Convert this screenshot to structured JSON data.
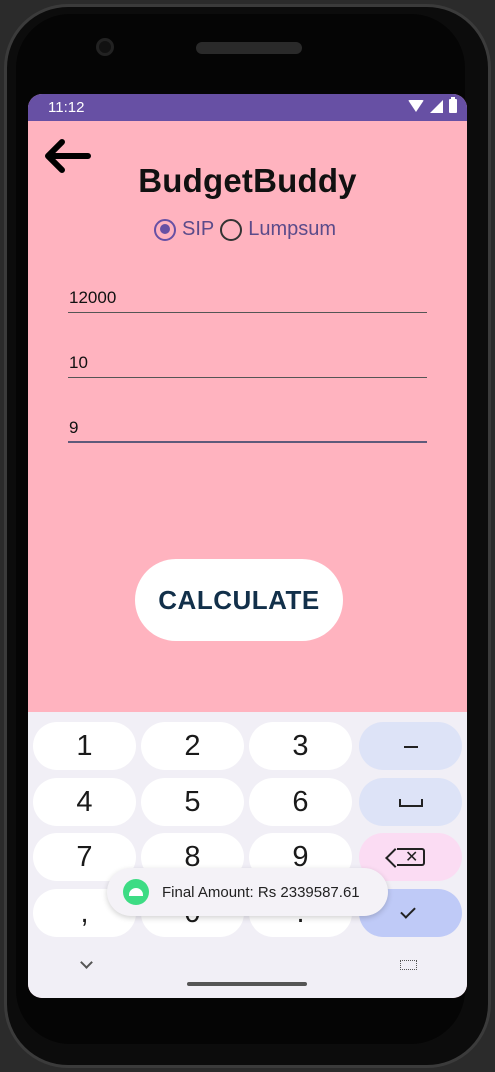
{
  "status_bar": {
    "time": "11:12"
  },
  "app": {
    "title": "BudgetBuddy",
    "radio_options": [
      {
        "label": "SIP",
        "checked": true
      },
      {
        "label": "Lumpsum",
        "checked": false
      }
    ],
    "fields": [
      {
        "value": "12000"
      },
      {
        "value": "10"
      },
      {
        "value": "9"
      }
    ],
    "calculate_label": "CALCULATE"
  },
  "colors": {
    "background": "#ffb3bf",
    "status_bar": "#6750a4",
    "accent": "#6750a4",
    "button_text": "#12304a"
  },
  "keyboard": {
    "rows": [
      [
        "1",
        "2",
        "3"
      ],
      [
        "4",
        "5",
        "6"
      ],
      [
        "7",
        "8",
        "9"
      ],
      [
        ",",
        "0",
        "."
      ]
    ]
  },
  "toast": {
    "text": "Final Amount: Rs 2339587.61"
  }
}
